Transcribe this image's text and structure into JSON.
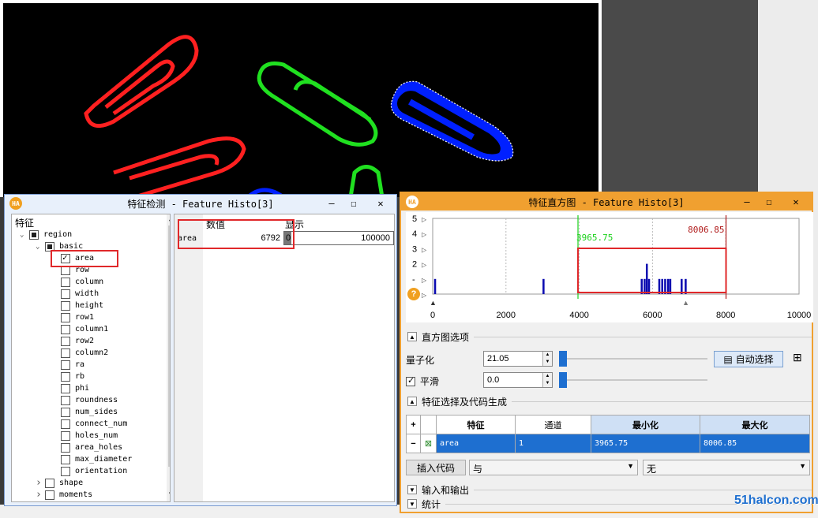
{
  "feature_window": {
    "title": "特征检测 - Feature Histo[3]",
    "tree_header": "特征",
    "value_header": "数值",
    "display_header": "显示",
    "tree": [
      {
        "label": "region",
        "level": 0,
        "arrow": "down",
        "check": "partial"
      },
      {
        "label": "basic",
        "level": 1,
        "arrow": "down",
        "check": "partial"
      },
      {
        "label": "area",
        "level": 2,
        "arrow": "",
        "check": "checked"
      },
      {
        "label": "row",
        "level": 2,
        "arrow": "",
        "check": "none"
      },
      {
        "label": "column",
        "level": 2,
        "arrow": "",
        "check": "none"
      },
      {
        "label": "width",
        "level": 2,
        "arrow": "",
        "check": "none"
      },
      {
        "label": "height",
        "level": 2,
        "arrow": "",
        "check": "none"
      },
      {
        "label": "row1",
        "level": 2,
        "arrow": "",
        "check": "none"
      },
      {
        "label": "column1",
        "level": 2,
        "arrow": "",
        "check": "none"
      },
      {
        "label": "row2",
        "level": 2,
        "arrow": "",
        "check": "none"
      },
      {
        "label": "column2",
        "level": 2,
        "arrow": "",
        "check": "none"
      },
      {
        "label": "ra",
        "level": 2,
        "arrow": "",
        "check": "none"
      },
      {
        "label": "rb",
        "level": 2,
        "arrow": "",
        "check": "none"
      },
      {
        "label": "phi",
        "level": 2,
        "arrow": "",
        "check": "none"
      },
      {
        "label": "roundness",
        "level": 2,
        "arrow": "",
        "check": "none"
      },
      {
        "label": "num_sides",
        "level": 2,
        "arrow": "",
        "check": "none"
      },
      {
        "label": "connect_num",
        "level": 2,
        "arrow": "",
        "check": "none"
      },
      {
        "label": "holes_num",
        "level": 2,
        "arrow": "",
        "check": "none"
      },
      {
        "label": "area_holes",
        "level": 2,
        "arrow": "",
        "check": "none"
      },
      {
        "label": "max_diameter",
        "level": 2,
        "arrow": "",
        "check": "none"
      },
      {
        "label": "orientation",
        "level": 2,
        "arrow": "",
        "check": "none"
      },
      {
        "label": "shape",
        "level": 1,
        "arrow": "right",
        "check": "none"
      },
      {
        "label": "moments",
        "level": 1,
        "arrow": "right",
        "check": "none"
      }
    ],
    "value_row": {
      "name": "area",
      "value": "6792",
      "bar_min": "0",
      "bar_max": "100000",
      "fraction": 0.0679
    }
  },
  "histogram_window": {
    "title": "特征直方图 - Feature Histo[3]",
    "help_icon": "?",
    "section_histogram": "直方图选项",
    "quantize_label": "量子化",
    "quantize_value": "21.05",
    "smooth_label": "平滑",
    "smooth_value": "0.0",
    "smooth_checked": true,
    "auto_select": "自动选择",
    "section_feature": "特征选择及代码生成",
    "table_headers": {
      "add": "+",
      "feature": "特征",
      "channel": "通道",
      "min": "最小化",
      "max": "最大化"
    },
    "table_row": {
      "remove": "−",
      "feature": "area",
      "channel": "1",
      "min": "3965.75",
      "max": "8006.85"
    },
    "insert_code": "插入代码",
    "combo_and": "与",
    "combo_none": "无",
    "section_io": "输入和输出",
    "section_stats": "统计"
  },
  "chart_data": {
    "type": "bar",
    "x_ticks": [
      0,
      2000,
      4000,
      6000,
      8000,
      10000
    ],
    "y_ticks": [
      "0",
      "1",
      "2",
      "3",
      "4",
      "5"
    ],
    "xlim": [
      0,
      10000
    ],
    "ylim": [
      0,
      5
    ],
    "bars": [
      {
        "x": 60,
        "y": 1
      },
      {
        "x": 3020,
        "y": 1
      },
      {
        "x": 5700,
        "y": 1
      },
      {
        "x": 5780,
        "y": 1
      },
      {
        "x": 5840,
        "y": 2
      },
      {
        "x": 5900,
        "y": 1
      },
      {
        "x": 6180,
        "y": 1
      },
      {
        "x": 6260,
        "y": 1
      },
      {
        "x": 6340,
        "y": 1
      },
      {
        "x": 6420,
        "y": 1
      },
      {
        "x": 6480,
        "y": 1
      },
      {
        "x": 6790,
        "y": 1
      },
      {
        "x": 6900,
        "y": 1
      }
    ],
    "min_threshold": {
      "value": 3965.75,
      "label": "3965.75",
      "color": "#1bd11b"
    },
    "max_threshold": {
      "value": 8006.85,
      "label": "8006.85",
      "color": "#b01a1a"
    },
    "marker_value": 6900,
    "bar_color": "#0a0ab0",
    "grid": true
  },
  "colors": {
    "highlight": "#e0282a",
    "accent": "#f0a030",
    "watermark": "#1e6fd0"
  },
  "watermark": "51halcon.com"
}
